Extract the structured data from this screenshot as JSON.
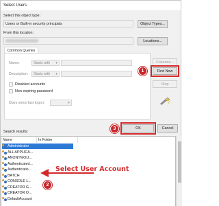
{
  "window": {
    "title": "Select Users"
  },
  "object_type": {
    "label": "Select this object type:",
    "value": "Users or Built-in security principals",
    "button": "Object Types..."
  },
  "location": {
    "label": "From this location:",
    "button": "Locations..."
  },
  "queries": {
    "tab": "Common Queries",
    "name_label": "Name:",
    "description_label": "Description:",
    "starts_with": "Starts with",
    "dropdown_arrow": "▾",
    "disabled_accounts": "Disabled accounts",
    "non_expiring_password": "Non expiring password",
    "days_since_logon": "Days since last logon:"
  },
  "side_buttons": {
    "columns": "Columns...",
    "find_now": "Find Now",
    "stop": "Stop"
  },
  "dialog_buttons": {
    "ok": "OK",
    "cancel": "Cancel"
  },
  "results": {
    "label": "Search results:",
    "columns": [
      "Name",
      "In Folder"
    ],
    "rows": [
      "Administrator",
      "ALL APPLICA...",
      "ANONYMOU...",
      "Authenticated...",
      "Authenticatio...",
      "BATCH",
      "CONSOLE L...",
      "CREATOR G...",
      "CREATOR O...",
      "DefaultAccount"
    ],
    "selected_index": 0
  },
  "annotations": {
    "step1": "1",
    "step2": "2",
    "step3": "3",
    "callout": "Select User Account",
    "color": "#d32a2a"
  }
}
